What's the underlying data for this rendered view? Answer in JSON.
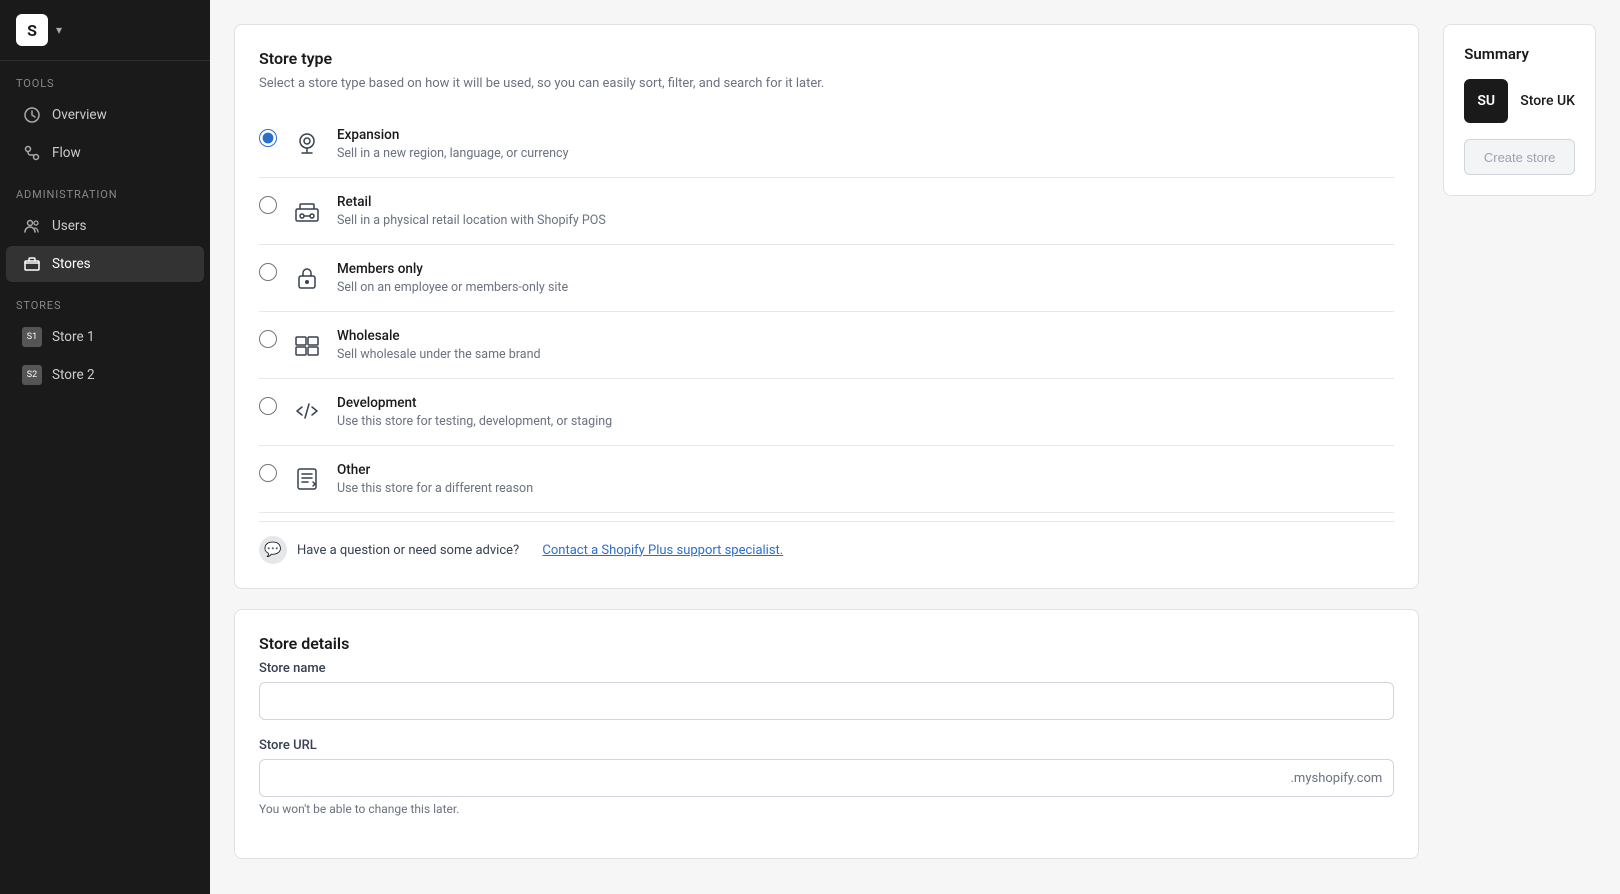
{
  "sidebar": {
    "logo_text": "S",
    "dropdown_icon": "▾",
    "sections": [
      {
        "label": "TOOLS",
        "items": [
          {
            "id": "overview",
            "label": "Overview",
            "icon": "overview"
          },
          {
            "id": "flow",
            "label": "Flow",
            "icon": "flow",
            "active": false
          }
        ]
      },
      {
        "label": "ADMINISTRATION",
        "items": [
          {
            "id": "users",
            "label": "Users",
            "icon": "users"
          },
          {
            "id": "stores",
            "label": "Stores",
            "icon": "stores",
            "active": true
          }
        ]
      },
      {
        "label": "STORES",
        "items": [
          {
            "id": "store1",
            "label": "Store 1",
            "abbr": "S1"
          },
          {
            "id": "store2",
            "label": "Store 2",
            "abbr": "S2"
          }
        ]
      }
    ]
  },
  "store_type": {
    "section_title": "Store type",
    "section_subtitle": "Select a store type based on how it will be used, so you can easily sort, filter, and search for it later.",
    "options": [
      {
        "id": "expansion",
        "label": "Expansion",
        "description": "Sell in a new region, language, or currency",
        "selected": true
      },
      {
        "id": "retail",
        "label": "Retail",
        "description": "Sell in a physical retail location with Shopify POS",
        "selected": false
      },
      {
        "id": "members_only",
        "label": "Members only",
        "description": "Sell on an employee or members-only site",
        "selected": false
      },
      {
        "id": "wholesale",
        "label": "Wholesale",
        "description": "Sell wholesale under the same brand",
        "selected": false
      },
      {
        "id": "development",
        "label": "Development",
        "description": "Use this store for testing, development, or staging",
        "selected": false
      },
      {
        "id": "other",
        "label": "Other",
        "description": "Use this store for a different reason",
        "selected": false
      }
    ],
    "support_text": "Have a question or need some advice?",
    "support_link": "Contact a Shopify Plus support specialist."
  },
  "store_details": {
    "section_title": "Store details",
    "name_label": "Store name",
    "name_placeholder": "",
    "url_label": "Store URL",
    "url_placeholder": "",
    "url_suffix": ".myshopify.com",
    "url_hint": "You won't be able to change this later."
  },
  "summary": {
    "title": "Summary",
    "avatar_text": "SU",
    "store_name": "Store UK",
    "create_button_label": "Create store"
  }
}
